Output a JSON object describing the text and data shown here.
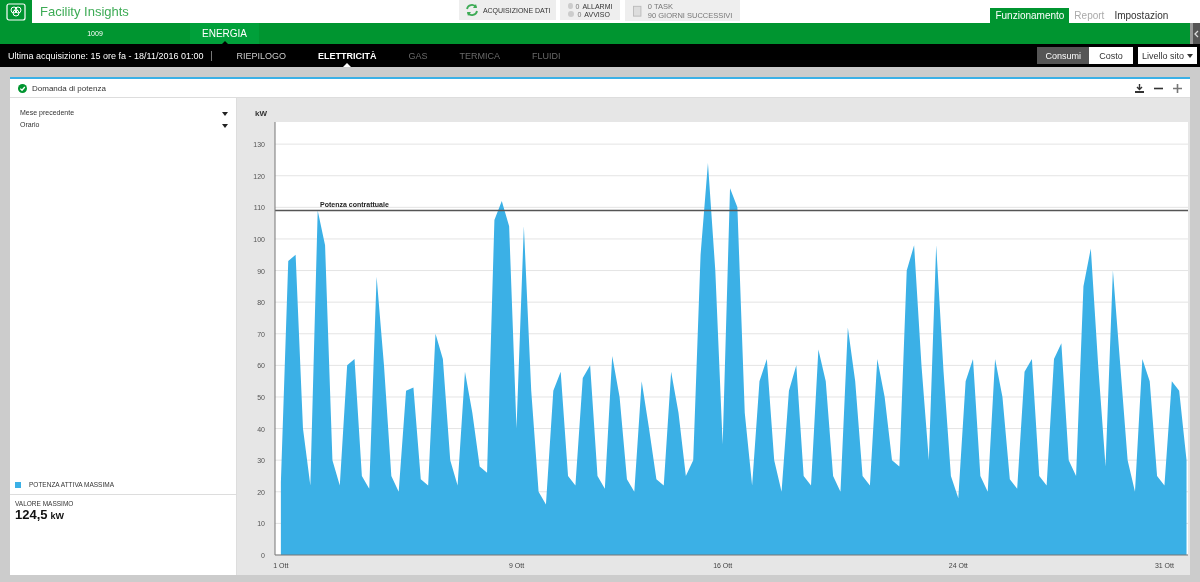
{
  "app": {
    "title": "Facility Insights"
  },
  "header": {
    "sync_button": "ACQUISIZIONE DATI",
    "alerts": [
      {
        "count": "0",
        "label": "ALLARMI"
      },
      {
        "count": "0",
        "label": "AVVISO"
      }
    ],
    "tasks": {
      "count": "0",
      "label": "TASK",
      "note": "90 GIORNI SUCCESSIVI"
    },
    "nav": [
      {
        "label": "Funzionamento",
        "selected": true
      },
      {
        "label": "Report",
        "selected": false
      },
      {
        "label": "Impostazion",
        "selected": false
      }
    ]
  },
  "site_bar": {
    "site": "1009",
    "tabs": [
      {
        "label": "ENERGIA",
        "selected": true
      }
    ]
  },
  "sub_bar": {
    "last_update": "Ultima acquisizione: 15 ore fa - 18/11/2016 01:00",
    "tabs": [
      {
        "label": "RIEPILOGO",
        "selected": false,
        "disabled": false
      },
      {
        "label": "ELETTRICITÀ",
        "selected": true,
        "disabled": false
      },
      {
        "label": "GAS",
        "selected": false,
        "disabled": true
      },
      {
        "label": "TERMICA",
        "selected": false,
        "disabled": true
      },
      {
        "label": "FLUIDI",
        "selected": false,
        "disabled": true
      }
    ],
    "toggle": [
      {
        "label": "Consumi",
        "selected": true
      },
      {
        "label": "Costo",
        "selected": false
      }
    ],
    "level_dropdown": "Livello sito"
  },
  "panel": {
    "title": "Domanda di potenza",
    "filters": [
      {
        "value": "Mese precedente"
      },
      {
        "value": "Orario"
      }
    ],
    "max": {
      "label": "VALORE MASSIMO",
      "value": "124,5",
      "unit": "kW"
    },
    "chart_data": {
      "type": "area",
      "ylabel": "kW",
      "xlim": [
        0.8,
        31.8
      ],
      "ylim": [
        0,
        137
      ],
      "yticks": [
        0,
        10,
        20,
        30,
        40,
        50,
        60,
        70,
        80,
        90,
        100,
        110,
        120,
        130
      ],
      "xticks": [
        {
          "value": 1,
          "label": "1 Ott"
        },
        {
          "value": 9,
          "label": "9 Ott"
        },
        {
          "value": 16,
          "label": "16 Ott"
        },
        {
          "value": 24,
          "label": "24 Ott"
        },
        {
          "value": 31,
          "label": "31 Ott"
        }
      ],
      "x": [
        1,
        1.25,
        1.5,
        1.75,
        2,
        2.25,
        2.5,
        2.75,
        3,
        3.25,
        3.5,
        3.75,
        4,
        4.25,
        4.5,
        4.75,
        5,
        5.25,
        5.5,
        5.75,
        6,
        6.25,
        6.5,
        6.75,
        7,
        7.25,
        7.5,
        7.75,
        8,
        8.25,
        8.5,
        8.75,
        9,
        9.25,
        9.5,
        9.75,
        10,
        10.25,
        10.5,
        10.75,
        11,
        11.25,
        11.5,
        11.75,
        12,
        12.25,
        12.5,
        12.75,
        13,
        13.25,
        13.5,
        13.75,
        14,
        14.25,
        14.5,
        14.75,
        15,
        15.25,
        15.5,
        15.75,
        16,
        16.25,
        16.5,
        16.75,
        17,
        17.25,
        17.5,
        17.75,
        18,
        18.25,
        18.5,
        18.75,
        19,
        19.25,
        19.5,
        19.75,
        20,
        20.25,
        20.5,
        20.75,
        21,
        21.25,
        21.5,
        21.75,
        22,
        22.25,
        22.5,
        22.75,
        23,
        23.25,
        23.5,
        23.75,
        24,
        24.25,
        24.5,
        24.75,
        25,
        25.25,
        25.5,
        25.75,
        26,
        26.25,
        26.5,
        26.75,
        27,
        27.25,
        27.5,
        27.75,
        28,
        28.25,
        28.5,
        28.75,
        29,
        29.25,
        29.5,
        29.75,
        30,
        30.25,
        30.5,
        30.75,
        31,
        31.25,
        31.5,
        31.75
      ],
      "series": [
        {
          "name": "POTENZA ATTIVA MASSIMA",
          "color": "#3bb0e6",
          "values": [
            23,
            93,
            95,
            40,
            22,
            109,
            98,
            30,
            22,
            60,
            62,
            25,
            21,
            88,
            60,
            25,
            20,
            52,
            53,
            24,
            22,
            70,
            62,
            30,
            22,
            58,
            45,
            28,
            26,
            106,
            112,
            104,
            40,
            104,
            52,
            20,
            16,
            52,
            58,
            25,
            22,
            56,
            60,
            25,
            21,
            63,
            50,
            24,
            20,
            55,
            40,
            24,
            22,
            58,
            45,
            25,
            30,
            95,
            124,
            90,
            35,
            116,
            110,
            45,
            22,
            55,
            62,
            30,
            20,
            52,
            60,
            25,
            22,
            65,
            55,
            25,
            20,
            72,
            55,
            25,
            22,
            62,
            50,
            30,
            28,
            90,
            98,
            60,
            30,
            98,
            58,
            25,
            18,
            55,
            62,
            25,
            20,
            62,
            50,
            24,
            21,
            58,
            62,
            25,
            22,
            62,
            67,
            30,
            25,
            85,
            97,
            60,
            28,
            90,
            60,
            30,
            20,
            62,
            55,
            25,
            22,
            55,
            52,
            30
          ]
        }
      ],
      "grid": true,
      "ref_lines": [
        {
          "axis": "y",
          "value": 109,
          "color": "#555555",
          "label": "Potenza contrattuale"
        }
      ]
    }
  }
}
